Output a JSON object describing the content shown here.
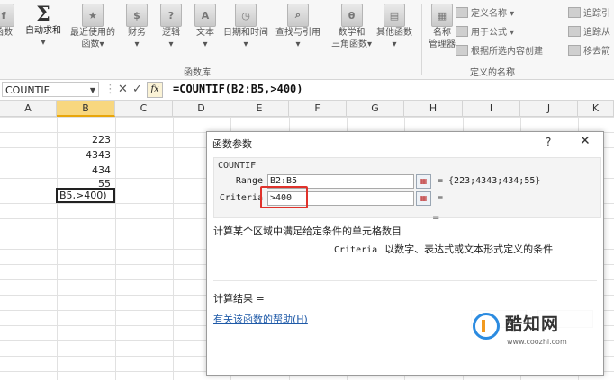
{
  "ribbon": {
    "buttons": [
      {
        "icon": "function-book-icon",
        "label": "函数",
        "label2": ""
      },
      {
        "icon": "sigma-icon",
        "label": "自动求和",
        "label2": "▾"
      },
      {
        "icon": "function-book-icon",
        "label": "最近使用的",
        "label2": "函数▾"
      },
      {
        "icon": "function-book-icon",
        "label": "财务",
        "label2": "▾"
      },
      {
        "icon": "function-book-icon",
        "label": "逻辑",
        "label2": "▾"
      },
      {
        "icon": "function-book-icon",
        "label": "文本",
        "label2": "▾"
      },
      {
        "icon": "function-book-icon",
        "label": "日期和时间",
        "label2": "▾"
      },
      {
        "icon": "function-book-icon",
        "label": "查找与引用",
        "label2": "▾"
      },
      {
        "icon": "function-book-icon",
        "label": "数学和",
        "label2": "三角函数▾"
      },
      {
        "icon": "function-book-icon",
        "label": "其他函数",
        "label2": "▾"
      },
      {
        "icon": "name-manager-icon",
        "label": "名称",
        "label2": "管理器"
      }
    ],
    "group_function_library": "函数库",
    "group_defined_names": "定义的名称",
    "defined_names_items": [
      "定义名称 ▾",
      "用于公式 ▾",
      "根据所选内容创建"
    ],
    "audit_items": [
      "追踪引",
      "追踪从",
      "移去箭"
    ]
  },
  "formula_bar": {
    "name_box": "COUNTIF",
    "fx_label": "fx",
    "formula": "=COUNTIF(B2:B5,>400)"
  },
  "sheet": {
    "columns": [
      "A",
      "B",
      "C",
      "D",
      "E",
      "F",
      "G",
      "H",
      "I",
      "J",
      "K"
    ],
    "b_values": [
      "223",
      "4343",
      "434",
      "55"
    ],
    "editing_cell_text": "B5,>400)"
  },
  "dialog": {
    "title": "函数参数",
    "help_glyph": "?",
    "close_glyph": "✕",
    "function_name": "COUNTIF",
    "args": [
      {
        "label": "Range",
        "value": "B2:B5",
        "result": "=  {223;4343;434;55}"
      },
      {
        "label": "Criteria",
        "value": ">400",
        "result": "="
      }
    ],
    "formula_result_eq": "=",
    "description": "计算某个区域中满足给定条件的单元格数目",
    "arg_desc_name": "Criteria",
    "arg_desc": "以数字、表达式或文本形式定义的条件",
    "result_label": "计算结果 =",
    "help_link": "有关该函数的帮助(H)"
  },
  "watermark": {
    "name": "酷知网",
    "url": "www.coozhi.com"
  },
  "colors": {
    "selected_column": "#f8d77f",
    "highlight_box": "#e0322b",
    "link": "#1f5aa8"
  }
}
